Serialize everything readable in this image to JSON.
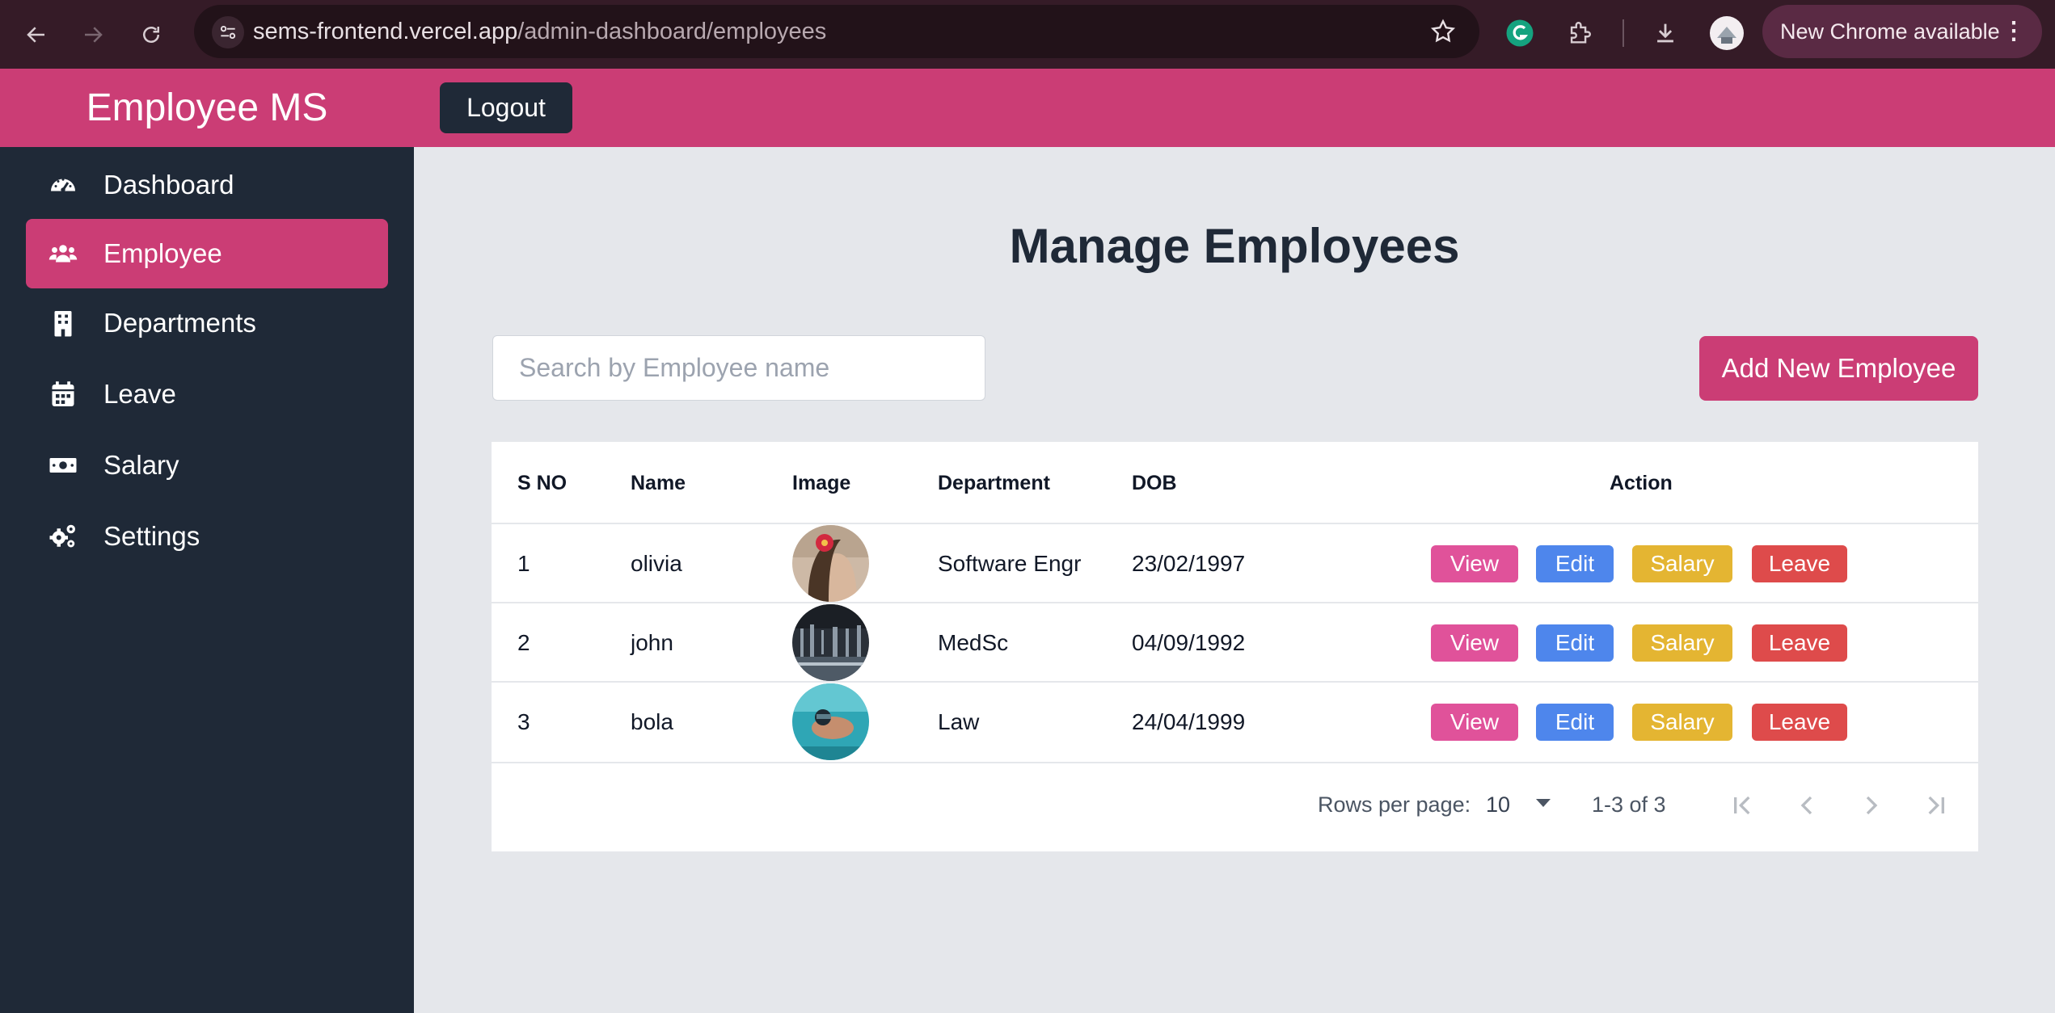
{
  "browser": {
    "url_domain": "sems-frontend.vercel.app",
    "url_path": "/admin-dashboard/employees",
    "update_label": "New Chrome available",
    "icons": [
      "back-icon",
      "forward-icon",
      "reload-icon",
      "site-settings-icon",
      "star-icon",
      "grammarly-icon",
      "extensions-icon",
      "download-icon",
      "profile-icon",
      "menu-icon"
    ]
  },
  "header": {
    "brand": "Employee MS",
    "logout_label": "Logout",
    "color": "#cb3d75"
  },
  "sidebar": {
    "items": [
      {
        "label": "Dashboard",
        "icon": "gauge-icon"
      },
      {
        "label": "Employee",
        "icon": "users-icon",
        "active": true
      },
      {
        "label": "Departments",
        "icon": "building-icon"
      },
      {
        "label": "Leave",
        "icon": "calendar-icon"
      },
      {
        "label": "Salary",
        "icon": "money-bill-icon"
      },
      {
        "label": "Settings",
        "icon": "cogs-icon"
      }
    ],
    "background": "#1f2937"
  },
  "main": {
    "title": "Manage Employees",
    "search_placeholder": "Search by Employee name",
    "add_button_label": "Add New Employee"
  },
  "table": {
    "columns": [
      "S NO",
      "Name",
      "Image",
      "Department",
      "DOB",
      "Action"
    ],
    "rows": [
      {
        "sno": "1",
        "name": "olivia",
        "image": "employee-photo",
        "department": "Software Engr",
        "dob": "23/02/1997"
      },
      {
        "sno": "2",
        "name": "john",
        "image": "employee-photo",
        "department": "MedSc",
        "dob": "04/09/1992"
      },
      {
        "sno": "3",
        "name": "bola",
        "image": "employee-photo",
        "department": "Law",
        "dob": "24/04/1999"
      }
    ],
    "actions": {
      "view": "View",
      "edit": "Edit",
      "salary": "Salary",
      "leave": "Leave"
    },
    "action_colors": {
      "view": "#e0529a",
      "edit": "#4e86ec",
      "salary": "#e4b532",
      "leave": "#de4b4b"
    }
  },
  "pagination": {
    "rows_per_page_label": "Rows per page:",
    "rows_per_page_value": "10",
    "range_text": "1-3 of 3"
  }
}
